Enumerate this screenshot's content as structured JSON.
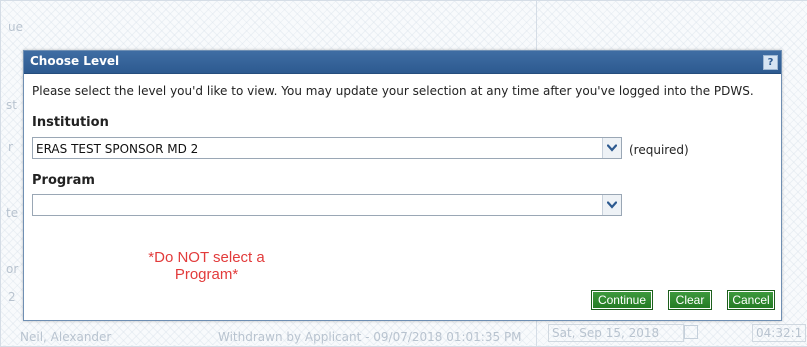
{
  "background": {
    "top_text": "ue",
    "left_fragments": [
      "st",
      "r",
      "te",
      "or",
      "2"
    ],
    "footer": {
      "name": "Neil, Alexander",
      "status": "Withdrawn by Applicant - 09/07/2018 01:01:35 PM",
      "date": "Sat, Sep 15, 2018",
      "time": "04:32:1"
    }
  },
  "dialog": {
    "title": "Choose Level",
    "help": "?",
    "intro": "Please select the level you'd like to view. You may update your selection at any time after you've logged into the PDWS.",
    "institution": {
      "label": "Institution",
      "value": "ERAS TEST SPONSOR MD 2",
      "required_note": "(required)"
    },
    "program": {
      "label": "Program",
      "value": ""
    },
    "annotation": {
      "line1": "*Do NOT select a",
      "line2": "Program*"
    },
    "buttons": {
      "continue": "Continue",
      "clear": "Clear",
      "cancel": "Cancel"
    }
  },
  "colors": {
    "titlebar": "#2d5a90",
    "button_green": "#2e8b2e",
    "annotation_red": "#e23b3b"
  }
}
